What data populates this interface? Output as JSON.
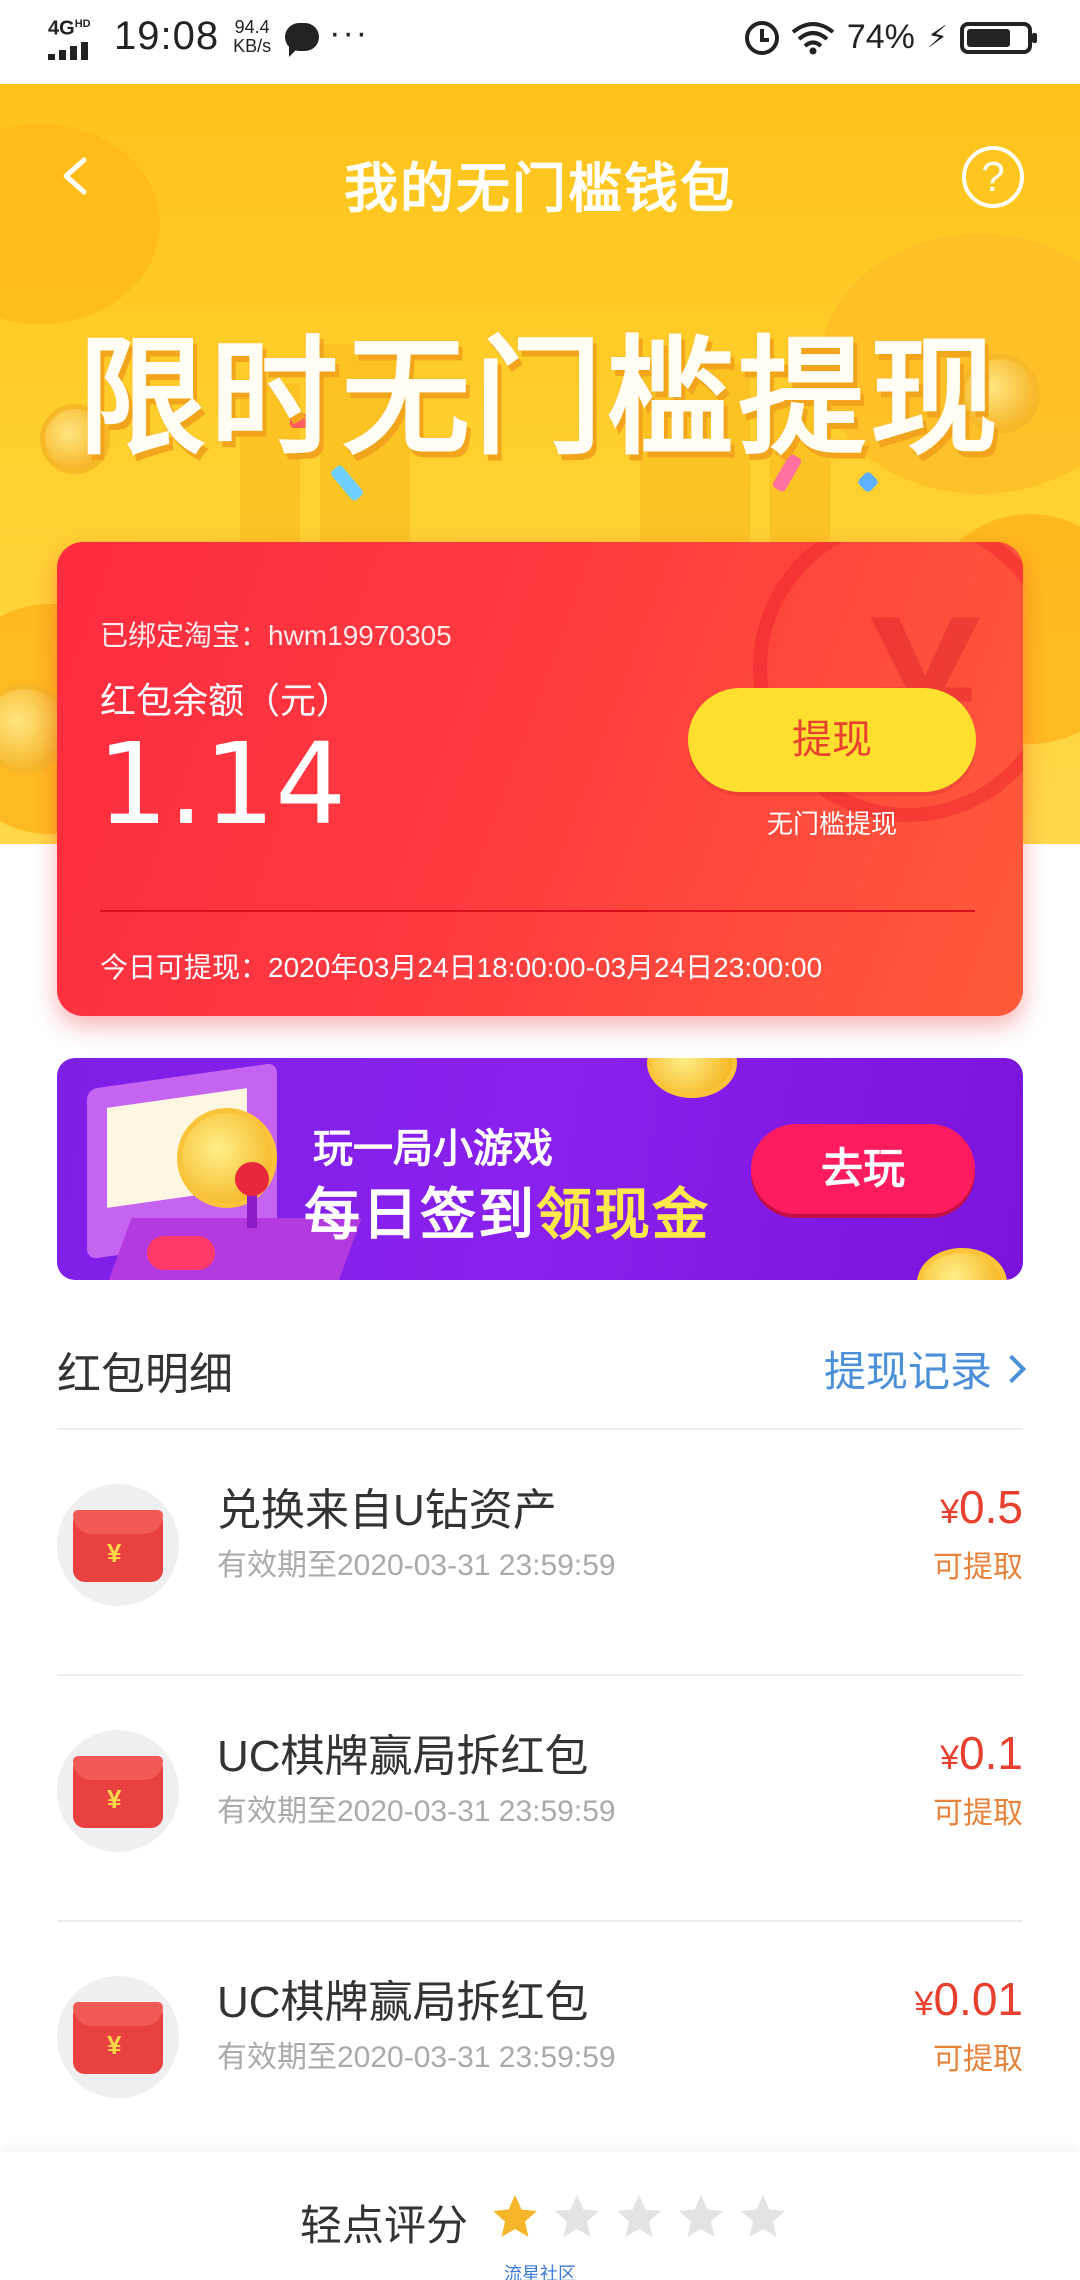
{
  "status_bar": {
    "network": "4G",
    "network_sub": "HD",
    "time": "19:08",
    "speed_value": "94.4",
    "speed_unit": "KB/s",
    "battery": "74%",
    "icons": [
      "signal-icon",
      "message-icon",
      "more-icon",
      "alarm-icon",
      "wifi-icon",
      "charging-icon",
      "battery-icon"
    ]
  },
  "header": {
    "title": "我的无门槛钱包",
    "back_icon": "chevron-left-icon",
    "help_label": "?",
    "banner": "限时无门槛提现"
  },
  "wallet": {
    "bound_label": "已绑定淘宝：hwm19970305",
    "balance_label": "红包余额（元）",
    "balance": "1.14",
    "withdraw_button": "提现",
    "withdraw_sub": "无门槛提现",
    "today_window": "今日可提现：2020年03月24日18:00:00-03月24日23:00:00"
  },
  "game_banner": {
    "line1": "玩一局小游戏",
    "line2_prefix": "每日签到",
    "line2_highlight": "领现金",
    "button": "去玩"
  },
  "list": {
    "title": "红包明细",
    "records_link": "提现记录",
    "items": [
      {
        "title": "兑换来自U钻资产",
        "expire": "有效期至2020-03-31 23:59:59",
        "currency": "¥",
        "amount": "0.5",
        "status": "可提取"
      },
      {
        "title": "UC棋牌赢局拆红包",
        "expire": "有效期至2020-03-31 23:59:59",
        "currency": "¥",
        "amount": "0.1",
        "status": "可提取"
      },
      {
        "title": "UC棋牌赢局拆红包",
        "expire": "有效期至2020-03-31 23:59:59",
        "currency": "¥",
        "amount": "0.01",
        "status": "可提取"
      }
    ]
  },
  "rating": {
    "label": "轻点评分",
    "value": 1,
    "max": 5,
    "watermark": "流星社区"
  },
  "colors": {
    "hero_yellow": "#ffc21a",
    "card_red": "#ff2b3f",
    "withdraw_yellow": "#ffe02e",
    "amount_red": "#e8402f",
    "status_orange": "#e8823a",
    "link_blue": "#4a8fd8",
    "game_purple": "#8a20ee",
    "play_pink": "#ff1c5e",
    "star_gold": "#f7b52a",
    "star_grey": "#e3e3e3"
  }
}
